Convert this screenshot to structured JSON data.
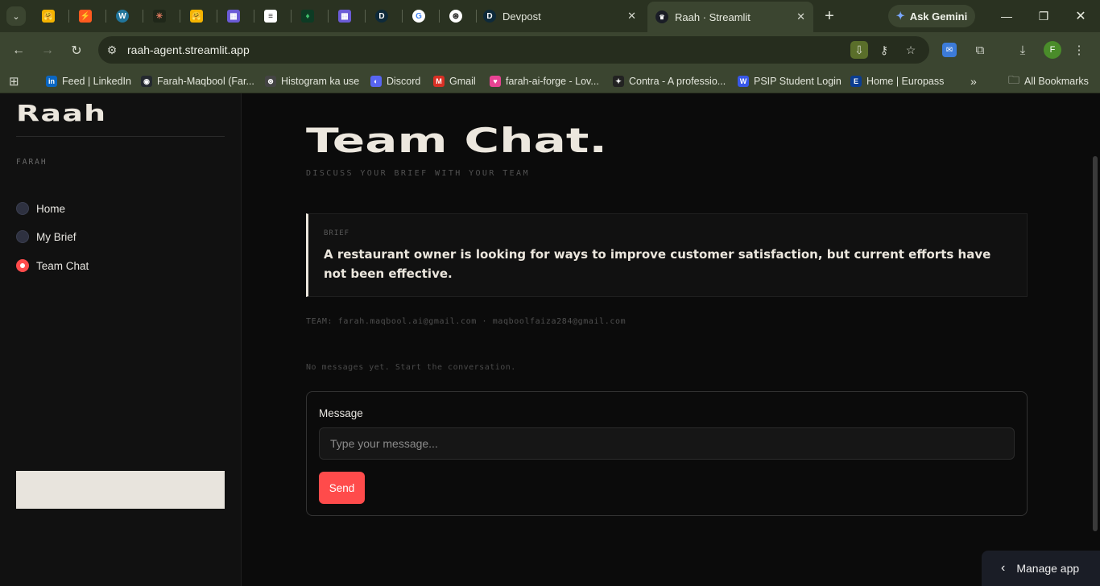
{
  "browser": {
    "tabs": [
      {
        "name": "tab-huggingface-1",
        "icon": "huggingface-icon",
        "glyph": "🤗"
      },
      {
        "name": "tab-bolt",
        "icon": "bolt-icon",
        "glyph": "⚡"
      },
      {
        "name": "tab-wordpress",
        "icon": "wordpress-icon",
        "glyph": "W"
      },
      {
        "name": "tab-claude",
        "icon": "claude-icon",
        "glyph": "✳"
      },
      {
        "name": "tab-huggingface-2",
        "icon": "huggingface-icon",
        "glyph": "🤗"
      },
      {
        "name": "tab-grid",
        "icon": "grid-app-icon",
        "glyph": "▦"
      },
      {
        "name": "tab-doc",
        "icon": "document-icon",
        "glyph": "≡"
      },
      {
        "name": "tab-mongodb",
        "icon": "leaf-icon",
        "glyph": "♦"
      },
      {
        "name": "tab-grid-2",
        "icon": "grid-app-icon",
        "glyph": "▦"
      },
      {
        "name": "tab-devpost-mini",
        "icon": "devpost-icon",
        "glyph": "D"
      },
      {
        "name": "tab-google",
        "icon": "google-icon",
        "glyph": "G"
      },
      {
        "name": "tab-chatgpt",
        "icon": "openai-icon",
        "glyph": "⊛"
      }
    ],
    "devpost_tab": "Devpost",
    "active_tab": "Raah · Streamlit",
    "ask_gemini": "Ask Gemini",
    "url": "raah-agent.streamlit.app",
    "bookmarks": [
      {
        "label": "Feed | LinkedIn",
        "icon": "linkedin-icon",
        "color": "#0a66c2",
        "glyph": "in"
      },
      {
        "label": "Farah-Maqbool (Far...",
        "icon": "github-icon",
        "color": "#24292f",
        "glyph": "◉"
      },
      {
        "label": "Histogram ka use",
        "icon": "openai-icon",
        "color": "#444",
        "glyph": "⊛"
      },
      {
        "label": "Discord",
        "icon": "discord-icon",
        "color": "#5865f2",
        "glyph": "◐"
      },
      {
        "label": "Gmail",
        "icon": "gmail-icon",
        "color": "#d93025",
        "glyph": "M"
      },
      {
        "label": "farah-ai-forge - Lov...",
        "icon": "lovable-icon",
        "color": "#e84393",
        "glyph": "♥"
      },
      {
        "label": "Contra - A professio...",
        "icon": "contra-icon",
        "color": "#222",
        "glyph": "✦"
      },
      {
        "label": "PSIP Student Login",
        "icon": "wordpress-icon",
        "color": "#3858e9",
        "glyph": "W"
      },
      {
        "label": "Home | Europass",
        "icon": "europass-icon",
        "color": "#0b3d91",
        "glyph": "E"
      }
    ],
    "all_bookmarks": "All Bookmarks"
  },
  "sidebar": {
    "logo": "Raah",
    "user": "FARAH",
    "nav": [
      {
        "label": "Home",
        "selected": false
      },
      {
        "label": "My Brief",
        "selected": false
      },
      {
        "label": "Team Chat",
        "selected": true
      }
    ]
  },
  "main": {
    "title": "Team Chat.",
    "subtitle": "DISCUSS YOUR BRIEF WITH YOUR TEAM",
    "brief_label": "BRIEF",
    "brief_text": "A restaurant owner is looking for ways to improve customer satisfaction, but current efforts have not been effective.",
    "team": "TEAM: farah.maqbool.ai@gmail.com  ·  maqboolfaiza284@gmail.com",
    "empty_state": "No messages yet. Start the conversation.",
    "form": {
      "label": "Message",
      "placeholder": "Type your message...",
      "send": "Send"
    },
    "manage_app": "Manage app"
  },
  "colors": {
    "accent": "#ff4b4b",
    "chrome_frame": "#2a3221",
    "chrome_toolbar": "#3b4530",
    "app_bg": "#0b0b0b",
    "cream": "#ebe6dd"
  }
}
